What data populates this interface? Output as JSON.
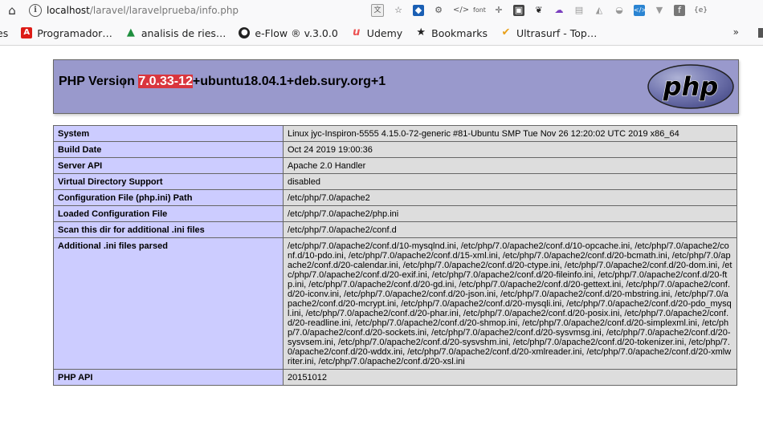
{
  "browser": {
    "url_host": "localhost",
    "url_path": "/laravel/laravelprueba/info.php",
    "bookmarks": [
      {
        "label": "es",
        "icon": "truncated"
      },
      {
        "label": "Programador…",
        "icon": "angular-icon"
      },
      {
        "label": "analisis de ries…",
        "icon": "drive-icon"
      },
      {
        "label": "e-Flow ® v.3.0.0",
        "icon": "github-icon"
      },
      {
        "label": "Udemy",
        "icon": "udemy-icon"
      },
      {
        "label": "Bookmarks",
        "icon": "star-icon"
      },
      {
        "label": "Ultrasurf - Top…",
        "icon": "ultrasurf-icon"
      }
    ],
    "overflow": "»"
  },
  "header": {
    "version_prefix": "PHP Version ",
    "version_highlight": "7.0.33-12",
    "version_suffix": "+ubuntu18.04.1+deb.sury.org+1",
    "logo_text": "php"
  },
  "rows": [
    {
      "label": "System",
      "value": "Linux jyc-Inspiron-5555 4.15.0-72-generic #81-Ubuntu SMP Tue Nov 26 12:20:02 UTC 2019 x86_64"
    },
    {
      "label": "Build Date",
      "value": "Oct 24 2019 19:00:36"
    },
    {
      "label": "Server API",
      "value": "Apache 2.0 Handler"
    },
    {
      "label": "Virtual Directory Support",
      "value": "disabled"
    },
    {
      "label": "Configuration File (php.ini) Path",
      "value": "/etc/php/7.0/apache2"
    },
    {
      "label": "Loaded Configuration File",
      "value": "/etc/php/7.0/apache2/php.ini"
    },
    {
      "label": "Scan this dir for additional .ini files",
      "value": "/etc/php/7.0/apache2/conf.d"
    },
    {
      "label": "Additional .ini files parsed",
      "value": "/etc/php/7.0/apache2/conf.d/10-mysqlnd.ini, /etc/php/7.0/apache2/conf.d/10-opcache.ini, /etc/php/7.0/apache2/conf.d/10-pdo.ini, /etc/php/7.0/apache2/conf.d/15-xml.ini, /etc/php/7.0/apache2/conf.d/20-bcmath.ini, /etc/php/7.0/apache2/conf.d/20-calendar.ini, /etc/php/7.0/apache2/conf.d/20-ctype.ini, /etc/php/7.0/apache2/conf.d/20-dom.ini, /etc/php/7.0/apache2/conf.d/20-exif.ini, /etc/php/7.0/apache2/conf.d/20-fileinfo.ini, /etc/php/7.0/apache2/conf.d/20-ftp.ini, /etc/php/7.0/apache2/conf.d/20-gd.ini, /etc/php/7.0/apache2/conf.d/20-gettext.ini, /etc/php/7.0/apache2/conf.d/20-iconv.ini, /etc/php/7.0/apache2/conf.d/20-json.ini, /etc/php/7.0/apache2/conf.d/20-mbstring.ini, /etc/php/7.0/apache2/conf.d/20-mcrypt.ini, /etc/php/7.0/apache2/conf.d/20-mysqli.ini, /etc/php/7.0/apache2/conf.d/20-pdo_mysql.ini, /etc/php/7.0/apache2/conf.d/20-phar.ini, /etc/php/7.0/apache2/conf.d/20-posix.ini, /etc/php/7.0/apache2/conf.d/20-readline.ini, /etc/php/7.0/apache2/conf.d/20-shmop.ini, /etc/php/7.0/apache2/conf.d/20-simplexml.ini, /etc/php/7.0/apache2/conf.d/20-sockets.ini, /etc/php/7.0/apache2/conf.d/20-sysvmsg.ini, /etc/php/7.0/apache2/conf.d/20-sysvsem.ini, /etc/php/7.0/apache2/conf.d/20-sysvshm.ini, /etc/php/7.0/apache2/conf.d/20-tokenizer.ini, /etc/php/7.0/apache2/conf.d/20-wddx.ini, /etc/php/7.0/apache2/conf.d/20-xmlreader.ini, /etc/php/7.0/apache2/conf.d/20-xmlwriter.ini, /etc/php/7.0/apache2/conf.d/20-xsl.ini"
    },
    {
      "label": "PHP API",
      "value": "20151012"
    }
  ],
  "colors": {
    "header_bg": "#9999cc",
    "label_bg": "#ccccff",
    "value_bg": "#dddddd",
    "highlight": "#d9363e"
  }
}
